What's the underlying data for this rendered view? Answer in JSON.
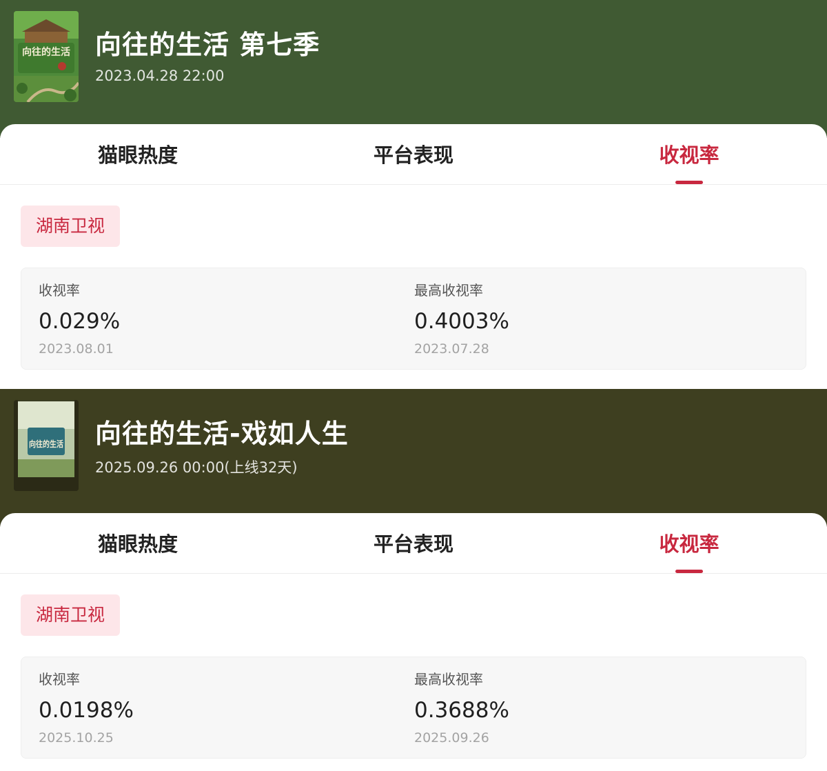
{
  "shows": [
    {
      "title": "向往的生活 第七季",
      "date": "2023.04.28 22:00",
      "header_color": "#405a33",
      "poster_text": "向往的生活",
      "poster_icon": "show-poster-image",
      "tabs": [
        "猫眼热度",
        "平台表现",
        "收视率"
      ],
      "active_tab": "收视率",
      "channel": "湖南卫视",
      "rating": {
        "label": "收视率",
        "value": "0.029%",
        "date": "2023.08.01"
      },
      "peak_rating": {
        "label": "最高收视率",
        "value": "0.4003%",
        "date": "2023.07.28"
      }
    },
    {
      "title": "向往的生活-戏如人生",
      "date": "2025.09.26 00:00(上线32天)",
      "header_color": "#3e3f20",
      "poster_text": "向往的生活",
      "poster_icon": "show-poster-image",
      "tabs": [
        "猫眼热度",
        "平台表现",
        "收视率"
      ],
      "active_tab": "收视率",
      "channel": "湖南卫视",
      "rating": {
        "label": "收视率",
        "value": "0.0198%",
        "date": "2025.10.25"
      },
      "peak_rating": {
        "label": "最高收视率",
        "value": "0.3688%",
        "date": "2025.09.26"
      }
    }
  ],
  "accent_color": "#c8283f"
}
